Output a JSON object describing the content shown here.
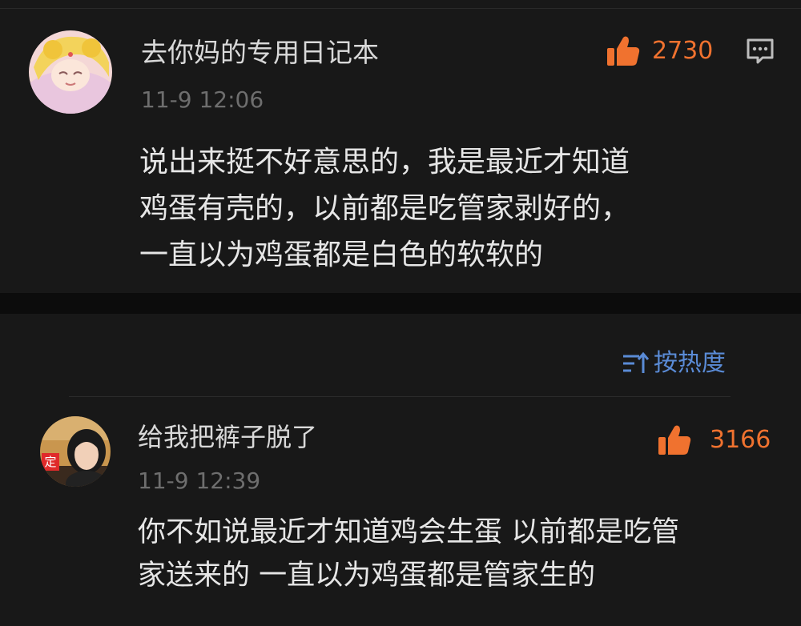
{
  "post": {
    "username": "去你妈的专用日记本",
    "time": "11-9 12:06",
    "likes": "2730",
    "body_lines": [
      "说出来挺不好意思的，我是最近才知道",
      "鸡蛋有壳的，以前都是吃管家剥好的，",
      "一直以为鸡蛋都是白色的软软的"
    ],
    "like_icon": "thumbs-up-icon",
    "reply_icon": "comment-icon"
  },
  "sort": {
    "label": "按热度",
    "icon": "sort-icon"
  },
  "reply": {
    "username": "给我把裤子脱了",
    "time": "11-9 12:39",
    "likes": "3166",
    "avatar_badge": "定",
    "body_lines": [
      "你不如说最近才知道鸡会生蛋 以前都是吃管",
      "家送来的 一直以为鸡蛋都是管家生的"
    ],
    "like_icon": "thumbs-up-icon"
  },
  "colors": {
    "accent_like": "#f0722f",
    "accent_sort": "#5a8bd6",
    "background": "#181818"
  }
}
